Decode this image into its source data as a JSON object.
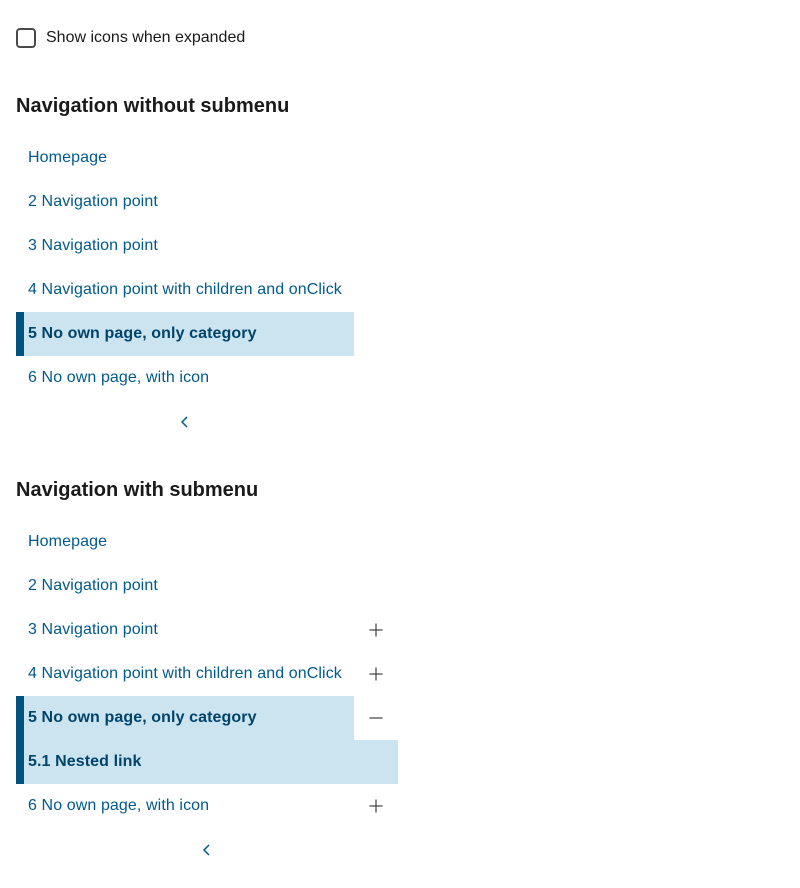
{
  "checkbox": {
    "label": "Show icons when expanded",
    "checked": false
  },
  "section1": {
    "title": "Navigation without submenu",
    "items": [
      {
        "label": "Homepage"
      },
      {
        "label": "2 Navigation point"
      },
      {
        "label": "3 Navigation point"
      },
      {
        "label": "4 Navigation point with children and onClick"
      },
      {
        "label": "5 No own page, only category",
        "active": true
      },
      {
        "label": "6 No own page, with icon"
      }
    ],
    "collapse_icon": "chevron-left-icon"
  },
  "section2": {
    "title": "Navigation with submenu",
    "items": [
      {
        "label": "Homepage"
      },
      {
        "label": "2 Navigation point"
      },
      {
        "label": "3 Navigation point",
        "toggle": "plus-icon"
      },
      {
        "label": "4 Navigation point with children and onClick",
        "toggle": "plus-icon"
      },
      {
        "label": "5 No own page, only category",
        "active": true,
        "toggle": "minus-icon"
      },
      {
        "label": "5.1 Nested link",
        "active": true,
        "nested": true
      },
      {
        "label": "6 No own page, with icon",
        "toggle": "plus-icon"
      }
    ],
    "collapse_icon": "chevron-left-icon"
  },
  "colors": {
    "link": "#005a8c",
    "active_bg": "#cce3f0",
    "active_bar": "#00527f",
    "active_text": "#00446b"
  }
}
